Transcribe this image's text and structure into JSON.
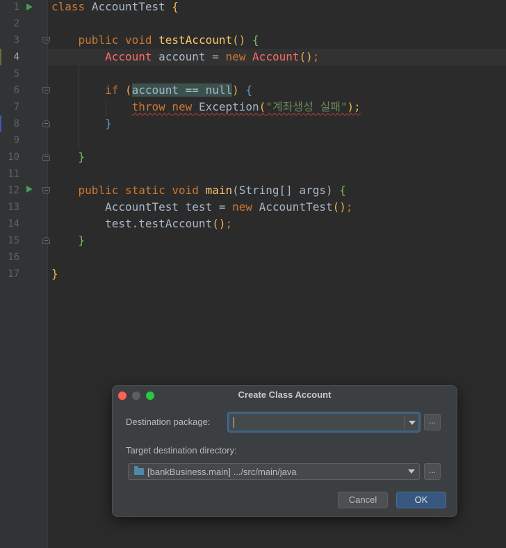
{
  "editor": {
    "line_numbers": [
      "1",
      "2",
      "3",
      "4",
      "5",
      "6",
      "7",
      "8",
      "9",
      "10",
      "11",
      "12",
      "13",
      "14",
      "15",
      "16",
      "17"
    ],
    "lines": {
      "l1": {
        "kw_class": "class",
        "name": "AccountTest",
        "brace": "{"
      },
      "l3": {
        "kw_public": "public",
        "kw_void": "void",
        "method": "testAccount",
        "parens": "()",
        "brace": "{"
      },
      "l4": {
        "type": "Account",
        "var": "account",
        "eq": "=",
        "kw_new": "new",
        "ctor": "Account",
        "parens": "()",
        "semi": ";"
      },
      "l6": {
        "kw_if": "if",
        "open_paren": "(",
        "cond": "account == null",
        "close_paren": ")",
        "brace": "{"
      },
      "l7": {
        "kw_throw": "throw",
        "kw_new": "new",
        "exc": "Exception",
        "open_paren": "(",
        "string": "\"계좌생성 실패\"",
        "close": ");"
      },
      "l8": {
        "brace": "}"
      },
      "l10": {
        "brace": "}"
      },
      "l12": {
        "kw_public": "public",
        "kw_static": "static",
        "kw_void": "void",
        "method": "main",
        "params": "(String[] args)",
        "brace": "{"
      },
      "l13": {
        "text": "AccountTest test = ",
        "kw_new": "new",
        "ctor": "AccountTest",
        "parens": "()",
        "semi": ";"
      },
      "l14": {
        "text": "test.testAccount",
        "parens": "()",
        "semi": ";"
      },
      "l15": {
        "brace": "}"
      },
      "l17": {
        "brace": "}"
      }
    }
  },
  "dialog": {
    "title": "Create Class Account",
    "destination_package_label": "Destination package:",
    "destination_package_value": "",
    "browse_label": "...",
    "target_dir_label": "Target destination directory:",
    "target_dir_value": "[bankBusiness.main] .../src/main/java",
    "cancel_label": "Cancel",
    "ok_label": "OK"
  },
  "colors": {
    "background": "#2b2b2b",
    "keyword": "#cc7832",
    "method": "#ffc66d",
    "error": "#ff6b68",
    "string": "#6a8759",
    "ok_button": "#365880"
  }
}
